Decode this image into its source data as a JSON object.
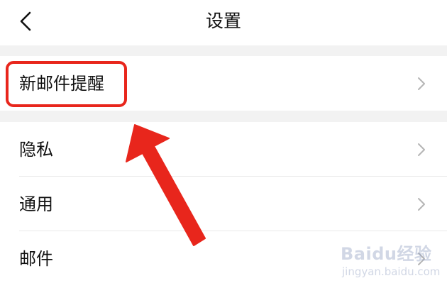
{
  "header": {
    "title": "设置",
    "back_icon": "chevron-left-icon"
  },
  "settings": {
    "items": [
      {
        "label": "新邮件提醒",
        "icon": "chevron-right-icon"
      },
      {
        "label": "隐私",
        "icon": "chevron-right-icon"
      },
      {
        "label": "通用",
        "icon": "chevron-right-icon"
      },
      {
        "label": "邮件",
        "icon": "chevron-right-icon"
      }
    ]
  },
  "annotation": {
    "highlight_color": "#e8261c"
  },
  "watermark": {
    "brand": "Baidu经验",
    "url": "jingyan.baidu.com"
  }
}
